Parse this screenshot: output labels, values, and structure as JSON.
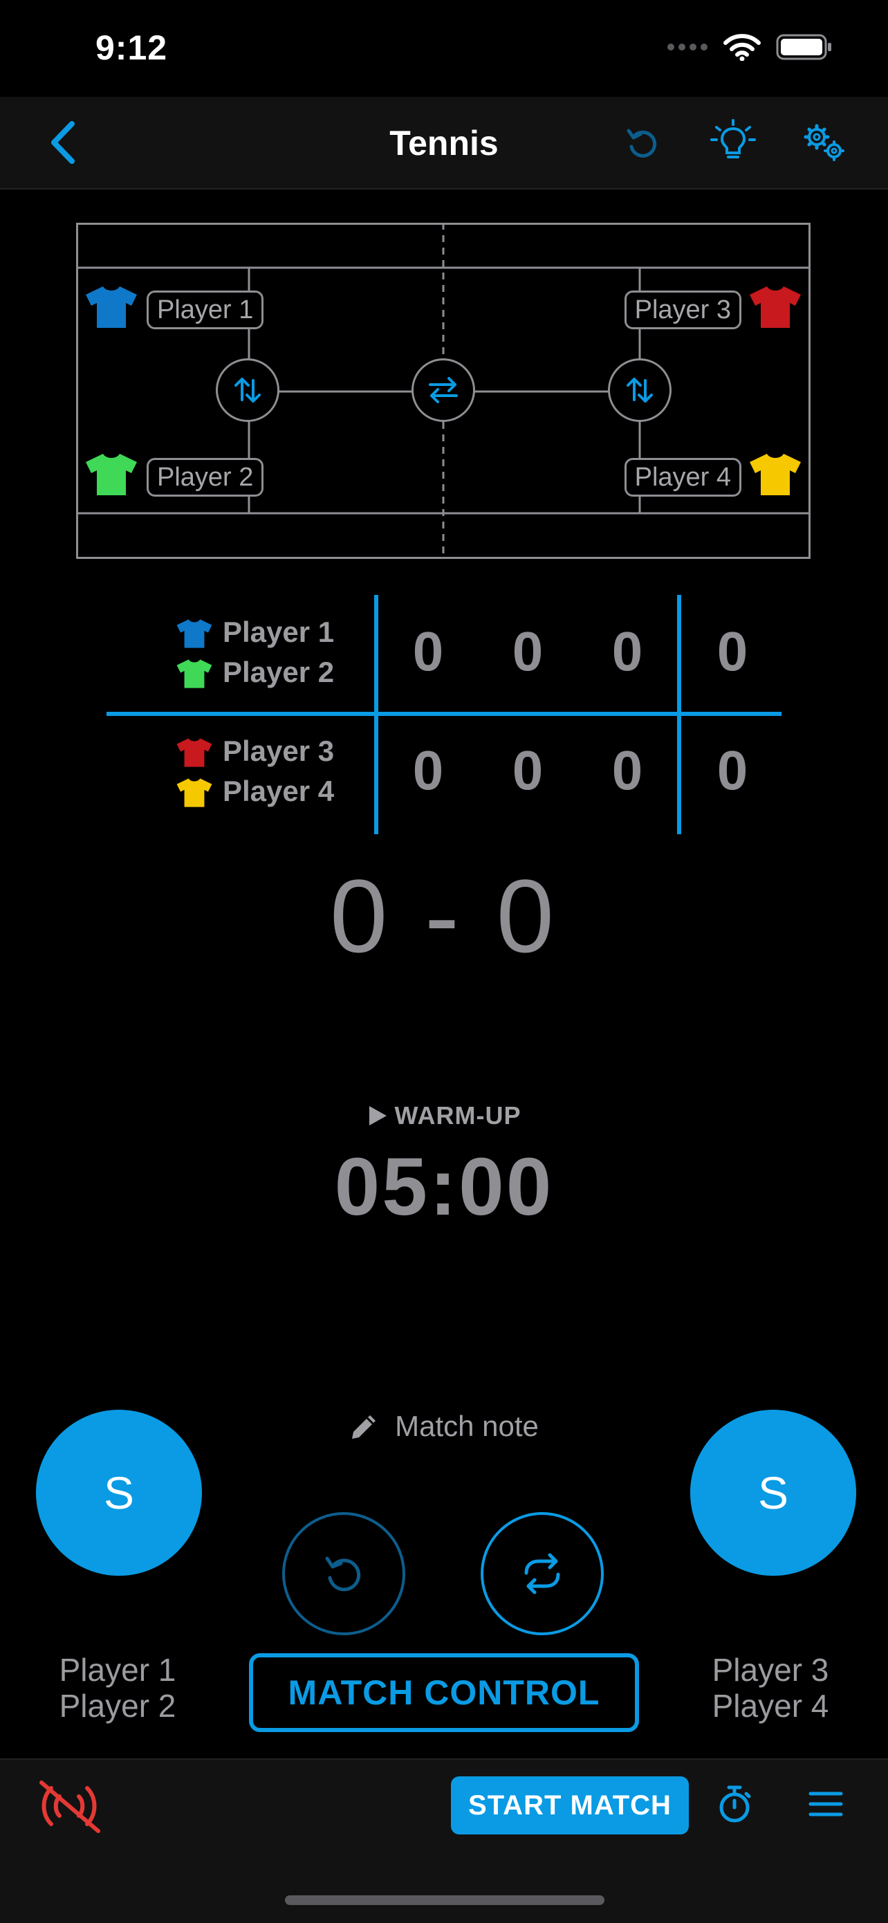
{
  "status": {
    "time": "9:12"
  },
  "nav": {
    "title": "Tennis"
  },
  "court": {
    "players": [
      {
        "name": "Player 1",
        "shirt_color": "#0f78c8"
      },
      {
        "name": "Player 2",
        "shirt_color": "#3fd957"
      },
      {
        "name": "Player 3",
        "shirt_color": "#c8191e"
      },
      {
        "name": "Player 4",
        "shirt_color": "#f5c800"
      }
    ]
  },
  "scoreboard": {
    "team_a": {
      "names": [
        "Player 1",
        "Player 2"
      ],
      "scores": [
        "0",
        "0",
        "0",
        "0"
      ]
    },
    "team_b": {
      "names": [
        "Player 3",
        "Player 4"
      ],
      "scores": [
        "0",
        "0",
        "0",
        "0"
      ]
    }
  },
  "match_score": "0 - 0",
  "timer": {
    "label": "WARM-UP",
    "value": "05:00"
  },
  "note": {
    "label": "Match note"
  },
  "serve": {
    "left_label": "S",
    "right_label": "S"
  },
  "teams": {
    "left": {
      "line1": "Player 1",
      "line2": "Player 2"
    },
    "right": {
      "line1": "Player 3",
      "line2": "Player 4"
    }
  },
  "controls": {
    "match_control": "MATCH CONTROL",
    "start_match": "START MATCH"
  },
  "colors": {
    "accent": "#0a9be4",
    "alert": "#e53935",
    "background": "#000000",
    "bar": "#121212"
  }
}
